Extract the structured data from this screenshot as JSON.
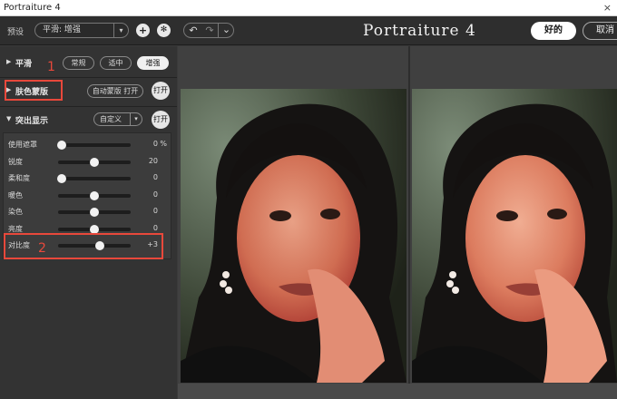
{
  "window": {
    "title": "Portraiture 4",
    "close_glyph": "×"
  },
  "toolbar": {
    "preset_label": "预设",
    "preset_value": "平滑: 增强",
    "add_glyph": "+",
    "settings_glyph": "✻",
    "undo_glyph": "↶",
    "redo_glyph": "↷",
    "history_glyph": "⌄",
    "logo": "Portraiture 4",
    "ok_label": "好的",
    "cancel_label": "取消"
  },
  "panel": {
    "smoothing": {
      "title": "平滑",
      "options": [
        "常规",
        "适中",
        "增强"
      ],
      "active_option": "增强"
    },
    "skin_mask": {
      "title": "肤色蒙版",
      "auto_mask_label": "自动蒙版 打开",
      "toggle_label": "打开"
    },
    "enhancement": {
      "title": "突出显示",
      "preset_value": "自定义",
      "toggle_label": "打开",
      "sliders": [
        {
          "label": "使用遮罩",
          "value": "0",
          "unit": "%",
          "level": 0.05
        },
        {
          "label": "锐度",
          "value": "20",
          "unit": "",
          "level": 0.5
        },
        {
          "label": "柔和度",
          "value": "0",
          "unit": "",
          "level": 0.05
        },
        {
          "label": "暖色",
          "value": "0",
          "unit": "",
          "level": 0.5
        },
        {
          "label": "染色",
          "value": "0",
          "unit": "",
          "level": 0.5
        },
        {
          "label": "亮度",
          "value": "0",
          "unit": "",
          "level": 0.5
        },
        {
          "label": "对比度",
          "value": "+3",
          "unit": "",
          "level": 0.57
        }
      ]
    }
  },
  "annotations": {
    "one": "1",
    "two": "2"
  },
  "colors": {
    "accent": "#e8483b",
    "panel_bg": "#333333",
    "button_bg": "#f0f0f0"
  }
}
